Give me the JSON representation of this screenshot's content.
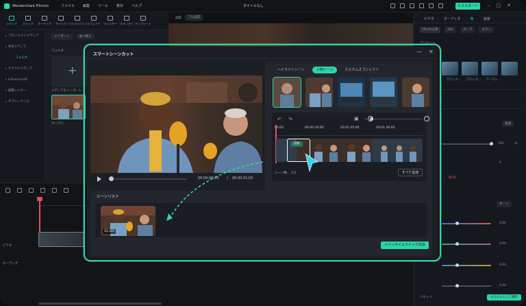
{
  "app": {
    "name": "Wondershare Filmora",
    "menu": [
      "ファイル",
      "編集",
      "ツール",
      "表示",
      "ヘルプ"
    ],
    "document_title": "タイトルなし",
    "export_label": "エクスポート",
    "accent_color": "#2dd4a7"
  },
  "left_tabs": [
    {
      "label": "メディア",
      "icon": "media-icon"
    },
    {
      "label": "ストック",
      "icon": "stock-icon"
    },
    {
      "label": "オーディオ",
      "icon": "music-icon"
    },
    {
      "label": "タイトル",
      "icon": "text-icon"
    },
    {
      "label": "トランジション",
      "icon": "transition-icon"
    },
    {
      "label": "エフェクト",
      "icon": "effect-icon"
    },
    {
      "label": "フィルター",
      "icon": "filter-icon"
    },
    {
      "label": "ステッカー",
      "icon": "sticker-icon"
    },
    {
      "label": "テンプレート",
      "icon": "template-icon"
    }
  ],
  "sidebar": {
    "items": [
      "プロジェクトメディア",
      "共有メディア",
      "フォルダ",
      "クラウドメディア",
      "Influence Kit",
      "調整レイヤー",
      "サブシーケンス"
    ]
  },
  "media": {
    "import_label": "インポート",
    "sort_label": "並べ替え",
    "folder_label": "フォルダ",
    "import_media_label": "メディアをインポート",
    "sample_label": "サンプル"
  },
  "viewer": {
    "quality_label": "画質",
    "fit_label": "フル品質"
  },
  "right_panel": {
    "tabs": [
      "ビデオ",
      "オーディオ",
      "色",
      "速度"
    ],
    "subtabs": [
      "ベーシック",
      "HSL",
      "カーブ",
      "カラー"
    ],
    "preset_label": "プリセット",
    "preset_names": [
      "ブロック...",
      "ブロック...",
      "ブースト..."
    ],
    "add_label": "追加",
    "value_1": "100",
    "unit_pct": "%",
    "value_0": "0",
    "val_a": "0.00",
    "val_b": "0.00",
    "val_c": "0.00",
    "val_d": "0.00",
    "reset_label": "リセット",
    "save_label": "カスタムとして保存",
    "auto_label": "オート",
    "new_badge": "NEW"
  },
  "timeline": {
    "track_video": "ビデオ",
    "track_audio": "オーディオ"
  },
  "modal": {
    "title": "スマートシーンカット",
    "min_glyph": "—",
    "close_glyph": "✕",
    "tabs": [
      "ハイライトシーン",
      "人物シーン",
      "カスタムオブジェクト"
    ],
    "active_tab": "人物シーン",
    "current_time": "00:00:00:00",
    "separator": "/",
    "total_time": "00:00:51:02",
    "ruler": [
      "00:00",
      "00:00:30:00",
      "00:01:00:00",
      "00:01:30:00"
    ],
    "add_tooltip": "追加",
    "count_label": "シーン数：",
    "count_value": "1/3",
    "add_all_label": "すべて追加",
    "scene_list_title": "シーンリスト",
    "scene_duration": "15.32s",
    "add_to_timeline_label": "メインタイムラインで追加"
  }
}
